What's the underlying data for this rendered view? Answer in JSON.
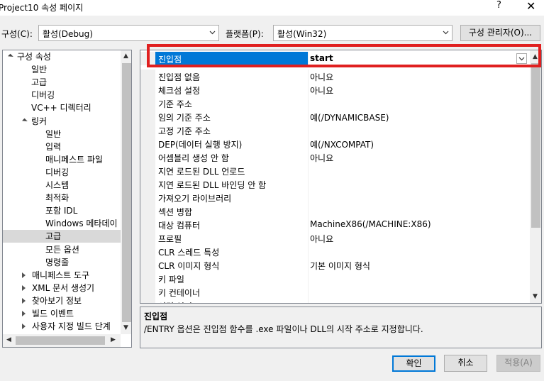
{
  "window": {
    "title": "Project10 속성 페이지",
    "help": "?",
    "close": "✕"
  },
  "config": {
    "config_label": "구성(C):",
    "config_value": "활성(Debug)",
    "platform_label": "플랫폼(P):",
    "platform_value": "활성(Win32)",
    "manager_button": "구성 관리자(O)..."
  },
  "tree": {
    "items": [
      {
        "label": "구성 속성",
        "state": "open"
      },
      {
        "label": "일반"
      },
      {
        "label": "고급"
      },
      {
        "label": "디버깅"
      },
      {
        "label": "VC++ 디렉터리"
      },
      {
        "label": "링커",
        "state": "open"
      },
      {
        "label": "일반"
      },
      {
        "label": "입력"
      },
      {
        "label": "매니페스트 파일"
      },
      {
        "label": "디버깅"
      },
      {
        "label": "시스템"
      },
      {
        "label": "최적화"
      },
      {
        "label": "포함 IDL"
      },
      {
        "label": "Windows 메타데이"
      },
      {
        "label": "고급",
        "selected": true
      },
      {
        "label": "모든 옵션"
      },
      {
        "label": "명령줄"
      },
      {
        "label": "매니페스트 도구",
        "state": "closed"
      },
      {
        "label": "XML 문서 생성기",
        "state": "closed"
      },
      {
        "label": "찾아보기 정보",
        "state": "closed"
      },
      {
        "label": "빌드 이벤트",
        "state": "closed"
      },
      {
        "label": "사용자 지정 빌드 단계",
        "state": "closed"
      }
    ]
  },
  "grid": {
    "rows": [
      {
        "name": "진입점",
        "value": "start",
        "selected": true
      },
      {
        "name": "진입점 없음",
        "value": "아니요"
      },
      {
        "name": "체크섬 설정",
        "value": "아니요"
      },
      {
        "name": "기준 주소",
        "value": ""
      },
      {
        "name": "임의 기준 주소",
        "value": "예(/DYNAMICBASE)"
      },
      {
        "name": "고정 기준 주소",
        "value": ""
      },
      {
        "name": "DEP(데이터 실행 방지)",
        "value": "예(/NXCOMPAT)"
      },
      {
        "name": "어셈블리 생성 안 함",
        "value": "아니요"
      },
      {
        "name": "지연 로드된 DLL 언로드",
        "value": ""
      },
      {
        "name": "지연 로드된 DLL 바인딩 안 함",
        "value": ""
      },
      {
        "name": "가져오기 라이브러리",
        "value": ""
      },
      {
        "name": "섹션 병합",
        "value": ""
      },
      {
        "name": "대상 컴퓨터",
        "value": "MachineX86(/MACHINE:X86)"
      },
      {
        "name": "프로필",
        "value": "아니요"
      },
      {
        "name": "CLR 스레드 특성",
        "value": ""
      },
      {
        "name": "CLR 이미지 형식",
        "value": "기본 이미지 형식"
      },
      {
        "name": "키 파일",
        "value": ""
      },
      {
        "name": "키 컨테이너",
        "value": ""
      },
      {
        "name": "서명 연기",
        "value": ""
      }
    ]
  },
  "description": {
    "title": "진입점",
    "text": "/ENTRY 옵션은 진입점 함수를 .exe 파일이나 DLL의 시작 주소로 지정합니다."
  },
  "buttons": {
    "ok": "확인",
    "cancel": "취소",
    "apply": "적용(A)"
  },
  "colors": {
    "selection": "#0078d7",
    "highlight_box": "#e02020"
  }
}
